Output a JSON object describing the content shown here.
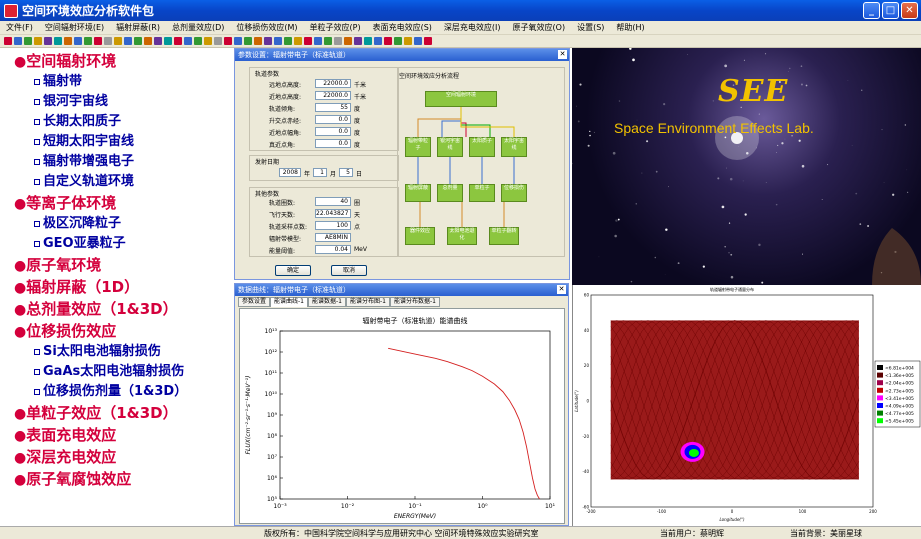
{
  "window": {
    "title": "空间环境效应分析软件包"
  },
  "menu": [
    "文件(F)",
    "空间辐射环境(E)",
    "辐射屏蔽(R)",
    "总剂量效应(D)",
    "位移损伤效应(M)",
    "单粒子效应(P)",
    "表面充电效应(S)",
    "深层充电效应(I)",
    "原子氧效应(O)",
    "设置(S)",
    "帮助(H)"
  ],
  "sidebar": {
    "items": [
      {
        "level": 1,
        "label": "空间辐射环境"
      },
      {
        "level": 2,
        "label": "辐射带"
      },
      {
        "level": 2,
        "label": "银河宇宙线"
      },
      {
        "level": 2,
        "label": "长期太阳质子"
      },
      {
        "level": 2,
        "label": "短期太阳宇宙线"
      },
      {
        "level": 2,
        "label": "辐射带增强电子"
      },
      {
        "level": 2,
        "label": "自定义轨道环境"
      },
      {
        "level": 1,
        "label": "等离子体环境"
      },
      {
        "level": 2,
        "label": "极区沉降粒子"
      },
      {
        "level": 2,
        "label": "GEO亚暴粒子"
      },
      {
        "level": 1,
        "label": "原子氧环境"
      },
      {
        "level": 1,
        "label": "辐射屏蔽（1D）"
      },
      {
        "level": 1,
        "label": "总剂量效应（1&3D）"
      },
      {
        "level": 1,
        "label": "位移损伤效应"
      },
      {
        "level": 2,
        "label": "Si太阳电池辐射损伤"
      },
      {
        "level": 2,
        "label": "GaAs太阳电池辐射损伤"
      },
      {
        "level": 2,
        "label": "位移损伤剂量（1&3D）"
      },
      {
        "level": 1,
        "label": "单粒子效应（1&3D）"
      },
      {
        "level": 1,
        "label": "表面充电效应"
      },
      {
        "level": 1,
        "label": "深层充电效应"
      },
      {
        "level": 1,
        "label": "原子氧腐蚀效应"
      }
    ]
  },
  "param_dialog": {
    "title": "参数设置：辐射带电子（标准轨道）",
    "orbit_group": "轨道参数",
    "fields": [
      {
        "label": "远地点高度:",
        "value": "22000.0",
        "unit": "千米"
      },
      {
        "label": "近地点高度:",
        "value": "22000.0",
        "unit": "千米"
      },
      {
        "label": "轨道倾角:",
        "value": "55",
        "unit": "度"
      },
      {
        "label": "升交点赤经:",
        "value": "0.0",
        "unit": "度"
      },
      {
        "label": "近地点幅角:",
        "value": "0.0",
        "unit": "度"
      },
      {
        "label": "真近点角:",
        "value": "0.0",
        "unit": "度"
      }
    ],
    "launch_group": "发射日期",
    "date": {
      "year": "2008",
      "year_unit": "年",
      "month": "1",
      "month_unit": "月",
      "day": "5",
      "day_unit": "日"
    },
    "other_group": "其他参数",
    "other_fields": [
      {
        "label": "轨道圈数:",
        "value": "40",
        "unit": "圈"
      },
      {
        "label": "飞行天数:",
        "value": "22.043827",
        "unit": "天"
      },
      {
        "label": "轨道采样点数:",
        "value": "100",
        "unit": "点"
      },
      {
        "label": "辐射带模型:",
        "value": "AE8MIN",
        "unit": ""
      },
      {
        "label": "能量阈值:",
        "value": "0.04",
        "unit": "MeV"
      }
    ],
    "ok": "确定",
    "cancel": "取消",
    "flow_title": "空间环境效应分析流程",
    "flow_top": "空间辐射环境",
    "flow_row1": [
      "辐射带粒子",
      "银河宇宙线",
      "太阳质子",
      "太阳宇宙线"
    ],
    "flow_row2": [
      "辐射屏蔽",
      "总剂量",
      "单粒子",
      "位移损伤"
    ],
    "flow_row3": [
      "器件效应",
      "太阳电池退化",
      "单粒子翻转"
    ]
  },
  "logo": {
    "title": "SEE",
    "subtitle": "Space Environment Effects Lab."
  },
  "chart_window": {
    "title": "数据曲线：辐射带电子（标准轨道）",
    "tabs": [
      "参数设置",
      "能谱曲线-1",
      "能谱数据-1",
      "能谱分布图-1",
      "能谱分布数据-1"
    ],
    "active_tab": 1
  },
  "chart_data": {
    "type": "line",
    "title": "辐射带电子（标准轨道）能谱曲线",
    "xlabel": "ENERGY(MeV)",
    "ylabel": "FLUX(cm⁻²·sr⁻¹·s⁻¹·MeV⁻¹)",
    "x_log": true,
    "y_log": true,
    "xlim": [
      0.001,
      10
    ],
    "ylim": [
      100000,
      10000000000000
    ],
    "x_ticks": [
      "10⁻³",
      "10⁻²",
      "10⁻¹",
      "10⁰",
      "10¹"
    ],
    "y_ticks": [
      "10⁵",
      "10⁶",
      "10⁷",
      "10⁸",
      "10⁹",
      "10¹⁰",
      "10¹¹",
      "10¹²",
      "10¹³"
    ],
    "series": [
      {
        "x": [
          0.04,
          0.1,
          0.2,
          0.3,
          0.5,
          0.7,
          1.0,
          1.5,
          2.0,
          2.5,
          3.0,
          3.5,
          4.0,
          4.5,
          5.0,
          5.5,
          6.0,
          6.5,
          7.0
        ],
        "y": [
          1500000000000.0,
          800000000000.0,
          500000000000.0,
          350000000000.0,
          200000000000.0,
          130000000000.0,
          70000000000.0,
          30000000000.0,
          13000000000.0,
          5000000000.0,
          1800000000.0,
          600000000.0,
          150000000.0,
          30000000.0,
          5000000.0,
          1000000.0,
          300000.0,
          150000.0,
          100000.0
        ]
      }
    ]
  },
  "map": {
    "title": "轨道辐射带电子通量分布",
    "xlabel": "Longitude(°)",
    "ylabel": "Latitude(°)",
    "x_ticks": [
      "-200",
      "-100",
      "0",
      "100",
      "200"
    ],
    "y_ticks": [
      "60",
      "40",
      "20",
      "0",
      "-20",
      "-40",
      "-60"
    ],
    "legend": [
      {
        "label": "<6.81e+004",
        "color": "#000000"
      },
      {
        "label": "<1.36e+005",
        "color": "#5a0000"
      },
      {
        "label": "<2.04e+005",
        "color": "#a0004a"
      },
      {
        "label": "<2.73e+005",
        "color": "#c00000"
      },
      {
        "label": "<3.41e+005",
        "color": "#ff00ff"
      },
      {
        "label": "<4.09e+005",
        "color": "#0000ff"
      },
      {
        "label": "<4.77e+005",
        "color": "#008000"
      },
      {
        "label": "<5.45e+005",
        "color": "#00ff00"
      }
    ]
  },
  "status": {
    "copyright": "版权所有：中国科学院空间科学与应用研究中心  空间环境特殊效应实验研究室",
    "user": "当前用户：蔡明辉",
    "background": "当前背景：美丽星球"
  }
}
